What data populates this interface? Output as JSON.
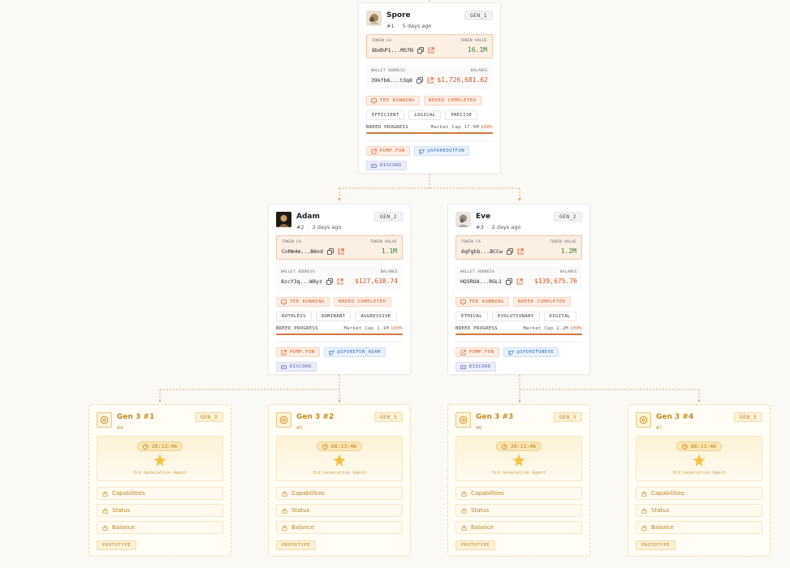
{
  "gen1": [
    {
      "name": "Spore",
      "id": "#1",
      "age": "5 days ago",
      "gen": "GEN_1",
      "token_label": "TOKEN CA",
      "token_value_label": "TOKEN VALUE",
      "token_ca": "8bdhP1...MS7N",
      "token_value": "16.1M",
      "wallet_label": "WALLET ADDRESS",
      "balance_label": "BALANCE",
      "wallet": "39kfb6...t3q8",
      "balance": "$1,726,681.62",
      "tee": "TEE RUNNING",
      "breed_status": "BREED COMPLETED",
      "traits": [
        "EFFICIENT",
        "LOGICAL",
        "PRECISE"
      ],
      "breed_label": "BREED PROGRESS",
      "market_cap": "Market Cap 17.5M",
      "pct": "100%",
      "progress": 1.0,
      "links": [
        "PUMP.FUN",
        "@SPOREDOTFUN"
      ],
      "discord": "DISCORD"
    }
  ],
  "gen2": [
    {
      "name": "Adam",
      "id": "#2",
      "age": "2 days ago",
      "gen": "GEN_2",
      "token_label": "TOKEN CA",
      "token_value_label": "TOKEN VALUE",
      "token_ca": "CnMm4m...B6nd",
      "token_value": "1.1M",
      "wallet_label": "WALLET ADDRESS",
      "balance_label": "BALANCE",
      "wallet": "8zcY3q...W8yz",
      "balance": "$127,638.74",
      "tee": "TEE RUNNING",
      "breed_status": "BREED COMPLETED",
      "traits": [
        "RUTHLESS",
        "DOMINANT",
        "AGGRESSIVE"
      ],
      "breed_label": "BREED PROGRESS",
      "market_cap": "Market Cap 1.1M",
      "pct": "100%",
      "progress": 1.0,
      "links": [
        "PUMP.FUN",
        "@SPOREFUN_ADAM"
      ],
      "discord": "DISCORD"
    },
    {
      "name": "Eve",
      "id": "#3",
      "age": "2 days ago",
      "gen": "GEN_2",
      "token_label": "TOKEN CA",
      "token_value_label": "TOKEN VALUE",
      "token_ca": "6qFgkb...BCCw",
      "token_value": "1.2M",
      "wallet_label": "WALLET ADDRESS",
      "balance_label": "BALANCE",
      "wallet": "HQSRUA...RGL1",
      "balance": "$139,675.76",
      "tee": "TEE RUNNING",
      "breed_status": "BREED COMPLETED",
      "traits": [
        "ETHICAL",
        "EVOLUTIONARY",
        "DIGITAL"
      ],
      "breed_label": "BREED PROGRESS",
      "market_cap": "Market Cap 1.2M",
      "pct": "100%",
      "progress": 1.0,
      "links": [
        "PUMP.FUN",
        "@SPOREFUNEVE"
      ],
      "discord": "DISCORD"
    }
  ],
  "gen3": [
    {
      "name": "Gen 3 #1",
      "id": "#4",
      "gen": "GEN_3",
      "timer": "20:13:46",
      "agent": "3rd Generation Agent",
      "rows": [
        "Capabilities",
        "Status",
        "Balance"
      ],
      "tag": "PROTOTYPE"
    },
    {
      "name": "Gen 3 #2",
      "id": "#5",
      "gen": "GEN_3",
      "timer": "68:13:46",
      "agent": "3rd Generation Agent",
      "rows": [
        "Capabilities",
        "Status",
        "Balance"
      ],
      "tag": "PROTOTYPE"
    },
    {
      "name": "Gen 3 #3",
      "id": "#6",
      "gen": "GEN_3",
      "timer": "20:13:46",
      "agent": "3rd Generation Agent",
      "rows": [
        "Capabilities",
        "Status",
        "Balance"
      ],
      "tag": "PROTOTYPE"
    },
    {
      "name": "Gen 3 #4",
      "id": "#7",
      "gen": "GEN_3",
      "timer": "68:13:46",
      "agent": "3rd Generation Agent",
      "rows": [
        "Capabilities",
        "Status",
        "Balance"
      ],
      "tag": "PROTOTYPE"
    }
  ],
  "colors": {
    "accent": "#d2541c",
    "positive": "#2e7d32",
    "prototype": "#c08a1e",
    "link_blue": "#2f6fb5",
    "line": "#e6a36c"
  }
}
